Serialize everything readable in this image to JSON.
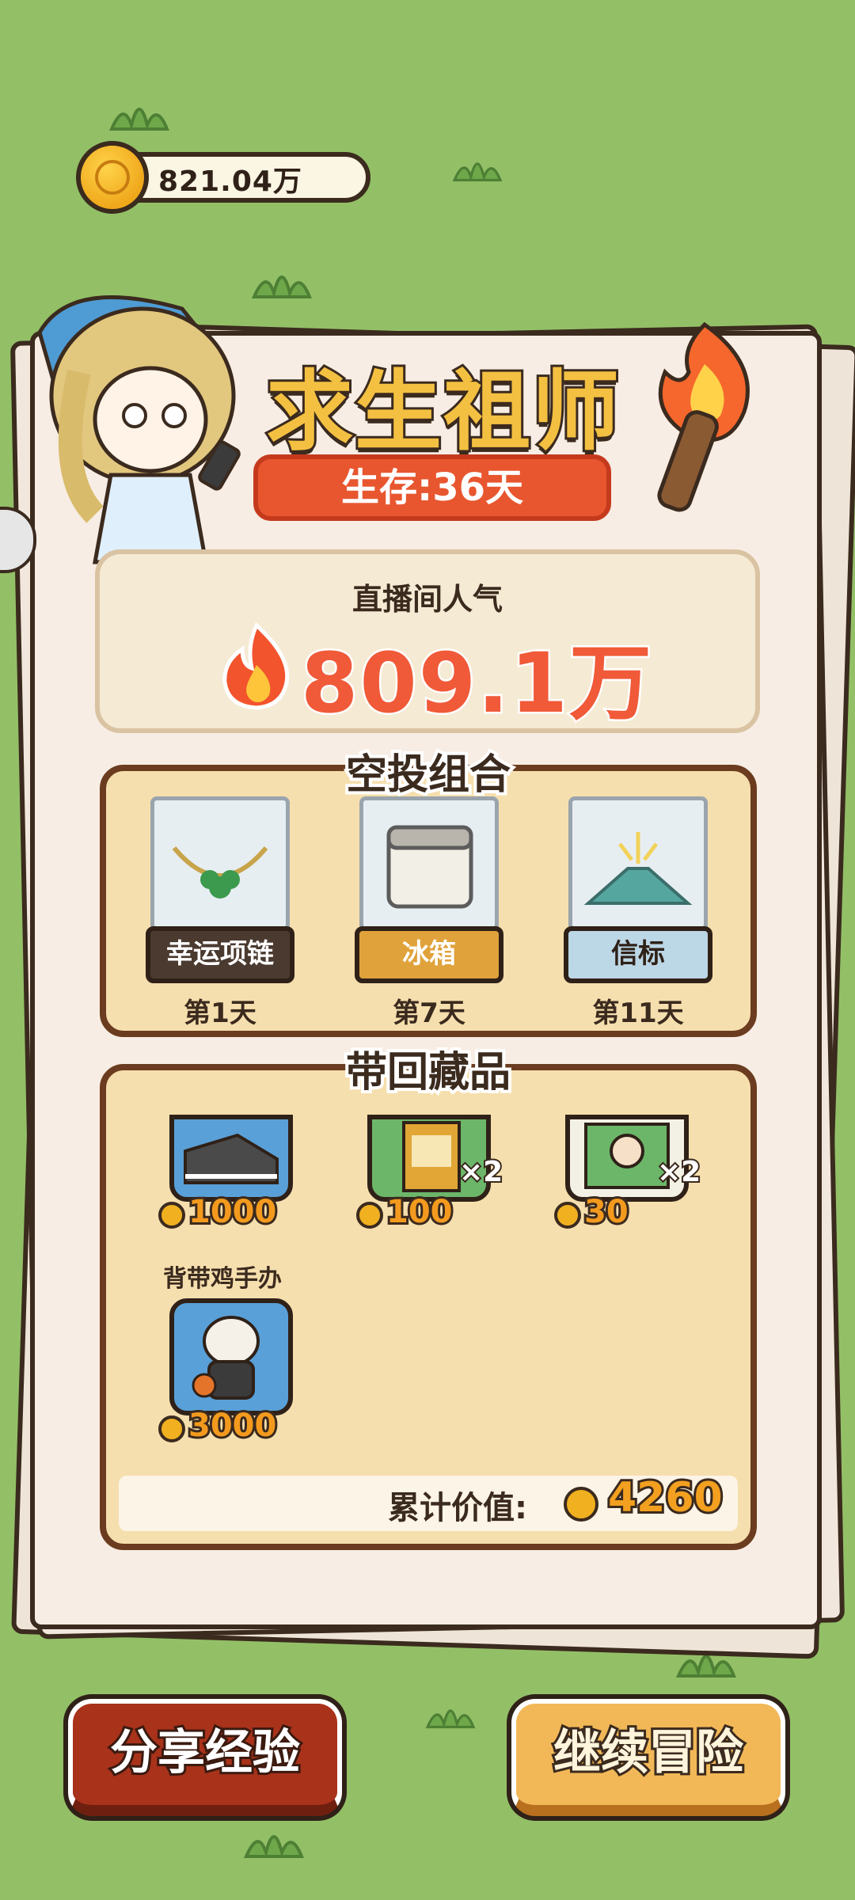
{
  "currency": {
    "value": "821.04万",
    "icon": "gold-coin-icon"
  },
  "title": "求生祖师",
  "survival": "生存:36天",
  "popularity": {
    "label": "直播间人气",
    "value": "809.1万",
    "icon": "fire-icon"
  },
  "airdrop": {
    "title": "空投组合",
    "items": [
      {
        "name": "幸运项链",
        "day": "第1天",
        "tag_color": "#4a3a30"
      },
      {
        "name": "冰箱",
        "day": "第7天",
        "tag_color": "#e0a23a"
      },
      {
        "name": "信标",
        "day": "第11天",
        "tag_color": "#bcd7e6"
      }
    ]
  },
  "collection": {
    "title": "带回藏品",
    "items": [
      {
        "label": "",
        "price": "1000",
        "count": "",
        "icon": "sneaker-icon"
      },
      {
        "label": "",
        "price": "100",
        "count": "×2",
        "icon": "book-icon"
      },
      {
        "label": "",
        "price": "30",
        "count": "×2",
        "icon": "photo-icon"
      },
      {
        "label": "背带鸡手办",
        "price": "3000",
        "count": "",
        "icon": "chicken-figure-icon"
      }
    ],
    "total_label": "累计价值:",
    "total_value": "4260"
  },
  "buttons": {
    "share": "分享经验",
    "continue": "继续冒险"
  },
  "colors": {
    "background": "#93c067",
    "title": "#f4c042",
    "survival_badge": "#e8562f",
    "popularity": "#f05a38"
  }
}
